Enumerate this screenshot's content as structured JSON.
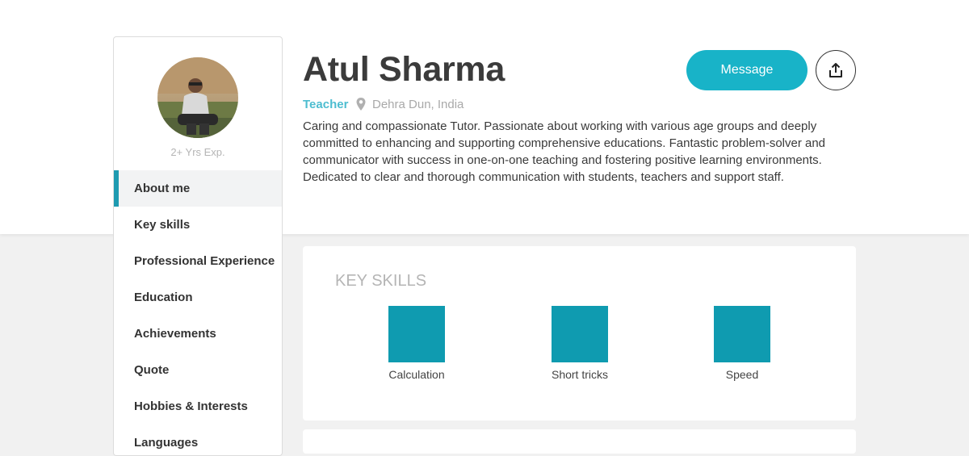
{
  "profile": {
    "name": "Atul Sharma",
    "role": "Teacher",
    "location": "Dehra Dun, India",
    "experience": "2+ Yrs Exp.",
    "bio": "Caring and compassionate Tutor. Passionate about working with various age groups and deeply committed to enhancing and supporting comprehensive educations. Fantastic problem-solver and communicator with success in one-on-one teaching and fostering positive learning environments. Dedicated to clear and thorough communication with students, teachers and support staff."
  },
  "actions": {
    "message_label": "Message",
    "share_icon": "share-icon"
  },
  "sidebar": {
    "items": [
      {
        "label": "About me",
        "active": true
      },
      {
        "label": "Key skills",
        "active": false
      },
      {
        "label": "Professional Experience",
        "active": false
      },
      {
        "label": "Education",
        "active": false
      },
      {
        "label": "Achievements",
        "active": false
      },
      {
        "label": "Quote",
        "active": false
      },
      {
        "label": "Hobbies & Interests",
        "active": false
      },
      {
        "label": "Languages",
        "active": false
      }
    ]
  },
  "skills": {
    "title": "KEY SKILLS",
    "items": [
      {
        "label": "Calculation"
      },
      {
        "label": "Short tricks"
      },
      {
        "label": "Speed"
      }
    ]
  },
  "colors": {
    "accent": "#18b3c8",
    "skill_tile": "#0f9bb0",
    "active_bar": "#1e9bb1",
    "role_text": "#4dbdd0"
  }
}
